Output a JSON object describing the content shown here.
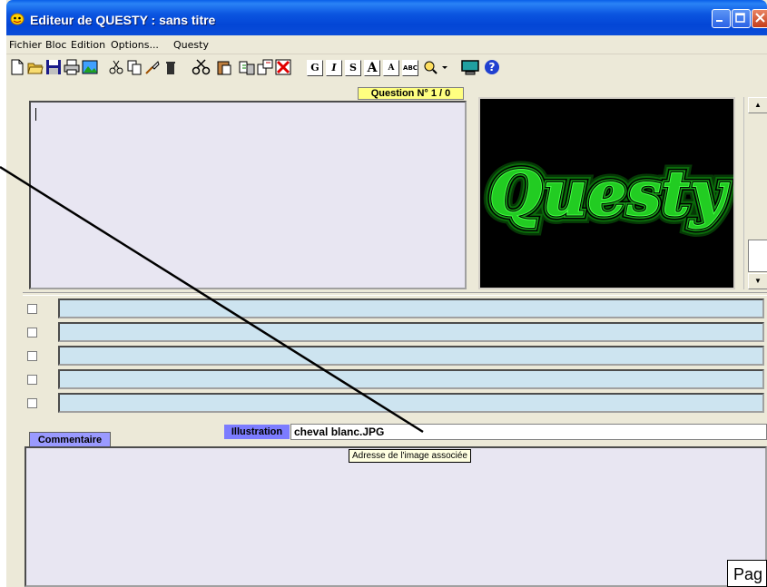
{
  "window": {
    "title": "Editeur de QUESTY : sans titre"
  },
  "menubar": {
    "items": [
      "Fichier",
      "Bloc",
      "Edition",
      "Options...",
      "Questy"
    ]
  },
  "toolbar": {
    "format_buttons": [
      "G",
      "I",
      "S",
      "A",
      "A",
      "ABC"
    ]
  },
  "question": {
    "label": "Question N° 1 / 0"
  },
  "preview": {
    "logo_text": "Questy",
    "logo_color": "#22cc22"
  },
  "answers": {
    "count": 5
  },
  "illustration": {
    "label": "Illustration",
    "value": "cheval blanc.JPG"
  },
  "tooltip": {
    "text": "Adresse de l'image associée"
  },
  "comment": {
    "tab_label": "Commentaire"
  },
  "page_label": {
    "text": "Pag"
  },
  "colors": {
    "title_blue": "#0346d6",
    "answer_bg": "#cde4f0",
    "question_label_bg": "#ffff80"
  }
}
